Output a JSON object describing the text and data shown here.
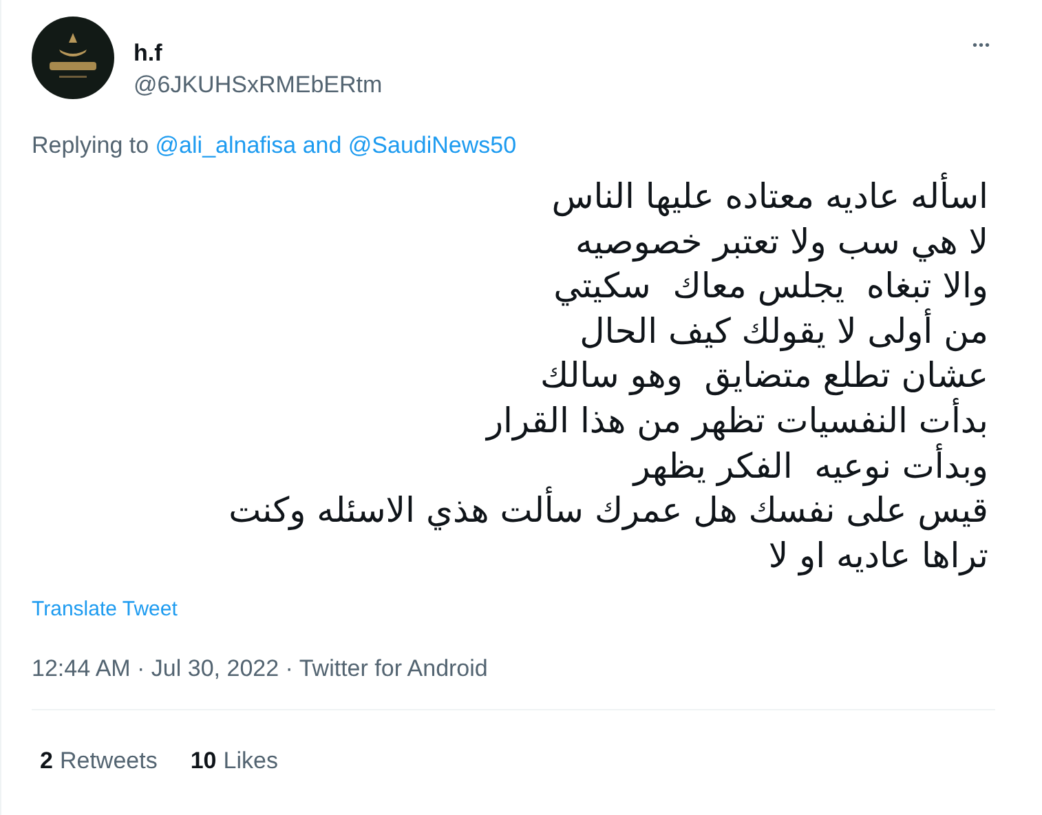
{
  "author": {
    "name": "h.f",
    "handle": "@6JKUHSxRMEbERtm"
  },
  "more": "•••",
  "reply": {
    "prefix": "Replying to",
    "mentions": "@ali_alnafisa and @SaudiNews50"
  },
  "body": [
    "اسأله عاديه معتاده عليها الناس",
    "لا هي سب ولا تعتبر خصوصيه",
    "والا تبغاه  يجلس معاك  سكيتي",
    "من أولى لا يقولك كيف الحال",
    "عشان تطلع متضايق  وهو سالك",
    "بدأت النفسيات تظهر من هذا القرار",
    "وبدأت نوعيه  الفكر يظهر",
    "قيس على نفسك هل عمرك سألت هذي الاسئله وكنت",
    "تراها عاديه او لا"
  ],
  "translate": "Translate Tweet",
  "meta": "12:44 AM · Jul 30, 2022 · Twitter for Android",
  "retweets": {
    "count": "2",
    "label": "Retweets"
  },
  "likes": {
    "count": "10",
    "label": "Likes"
  }
}
